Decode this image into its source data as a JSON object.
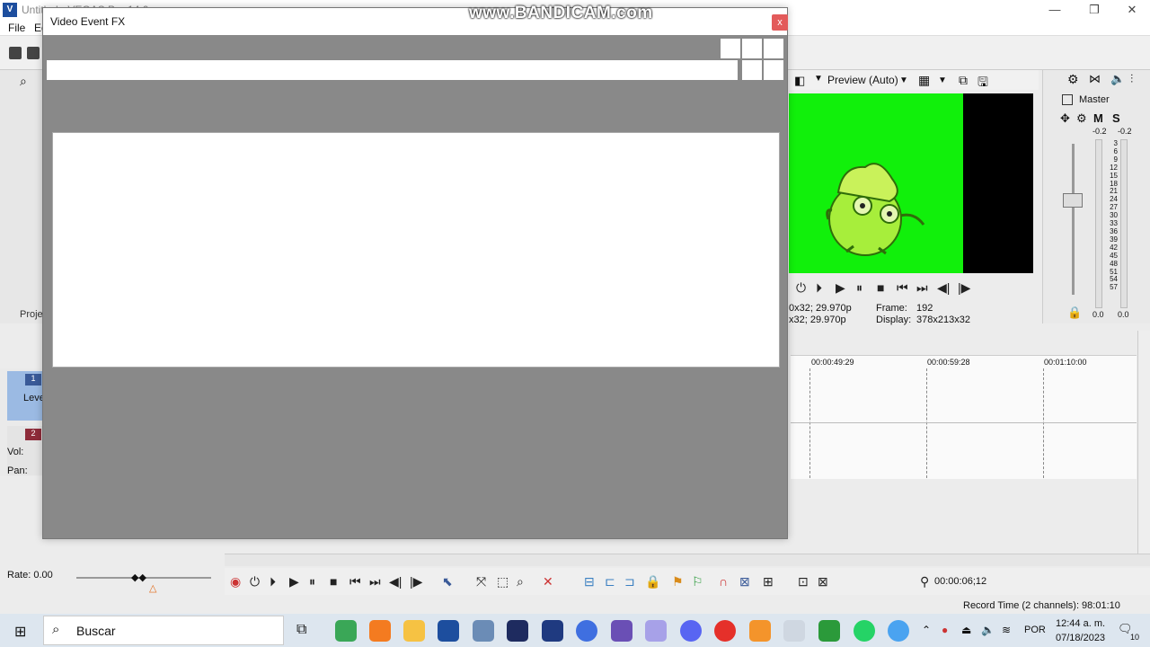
{
  "app": {
    "title": "Untitled - VEGAS Pro 14.0",
    "logo": "V",
    "controls": [
      "—",
      "❐",
      "✕"
    ],
    "menu": [
      "File",
      "Ed"
    ]
  },
  "watermark": "www.BANDICAM.com",
  "dialog": {
    "title": "Video Event FX",
    "close_label": "x"
  },
  "left_pane": {
    "tab": "Proje",
    "track1_label": "Leve",
    "track1_number": "1",
    "track2_number": "2",
    "vol_label": "Vol:",
    "pan_label": "Pan:",
    "rate_label": "Rate: 0.00"
  },
  "preview": {
    "mode": "Preview (Auto)",
    "info_line1": "0x32; 29.970p",
    "info_line2": "x32; 29.970p",
    "frame_label": "Frame:",
    "frame_value": "192",
    "display_label": "Display:",
    "display_value": "378x213x32"
  },
  "mixer": {
    "master_label": "Master",
    "m_label": "M",
    "s_label": "S",
    "peak_left": "-0.2",
    "peak_right": "-0.2",
    "db_marks": [
      "3",
      "6",
      "9",
      "12",
      "15",
      "18",
      "21",
      "24",
      "27",
      "30",
      "33",
      "36",
      "39",
      "42",
      "45",
      "48",
      "51",
      "54",
      "57"
    ],
    "bottom_left": "0.0",
    "bottom_right": "0.0",
    "bottom_mid": "0.0"
  },
  "timeline": {
    "ruler": [
      "00:00:49:29",
      "00:00:59:28",
      "00:01:10:00"
    ],
    "timecode": "00:00:06;12",
    "record_time": "Record Time (2 channels): 98:01:10"
  },
  "taskbar": {
    "search_placeholder": "Buscar",
    "lang": "POR",
    "time": "12:44 a. m.",
    "date": "07/18/2023",
    "notif_count": "10",
    "icon_colors": {
      "chrome": "#3aa757",
      "audacity": "#f47b20",
      "files": "#f6c243",
      "vegas1": "#1d4e9e",
      "media": "#6b8cb6",
      "v1": "#1e2b5f",
      "v2": "#1f3a80",
      "vblue": "#3f6fe0",
      "game": "#6a4fb5",
      "anime": "#a7a1e8",
      "discord": "#5865f2",
      "record": "#e5302a",
      "fl": "#f4942b",
      "white": "#cfd7e1",
      "xbox": "#2b9a3a",
      "whatsapp": "#25d366",
      "edge": "#4aa3f0"
    }
  }
}
